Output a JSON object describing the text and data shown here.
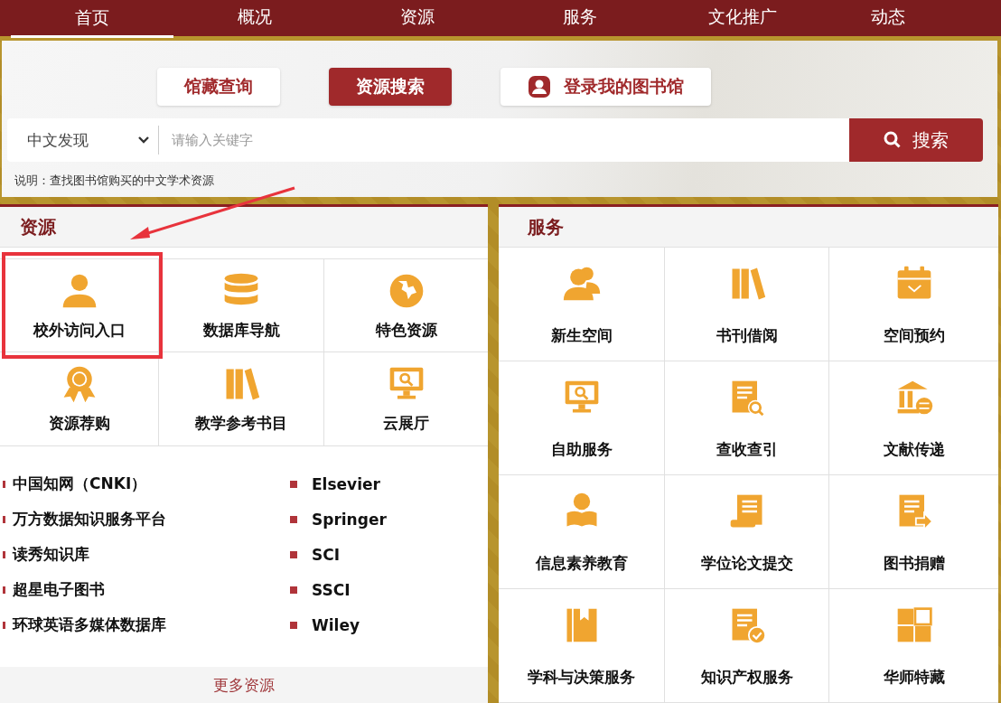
{
  "nav": [
    {
      "label": "首页",
      "selected": true
    },
    {
      "label": "概况",
      "selected": false
    },
    {
      "label": "资源",
      "selected": false
    },
    {
      "label": "服务",
      "selected": false
    },
    {
      "label": "文化推广",
      "selected": false
    },
    {
      "label": "动态",
      "selected": false
    }
  ],
  "search": {
    "tabs": [
      {
        "label": "馆藏查询",
        "selected": false
      },
      {
        "label": "资源搜索",
        "selected": true
      },
      {
        "label": "登录我的图书馆",
        "selected": false
      }
    ],
    "scope": "中文发现",
    "placeholder": "请输入关键字",
    "button": "搜索",
    "note": "说明：查找图书馆购买的中文学术资源"
  },
  "resources": {
    "title": "资源",
    "items": [
      {
        "label": "校外访问入口",
        "annotated": true
      },
      {
        "label": "数据库导航",
        "annotated": false
      },
      {
        "label": "特色资源",
        "annotated": false
      },
      {
        "label": "资源荐购",
        "annotated": false
      },
      {
        "label": "教学参考书目",
        "annotated": false
      },
      {
        "label": "云展厅",
        "annotated": false
      }
    ],
    "databases": [
      "中国知网（CNKI）",
      "Elsevier",
      "万方数据知识服务平台",
      "Springer",
      "读秀知识库",
      "SCI",
      "超星电子图书",
      "SSCI",
      "环球英语多媒体数据库",
      "Wiley"
    ],
    "more": "更多资源"
  },
  "services": {
    "title": "服务",
    "items": [
      "新生空间",
      "书刊借阅",
      "空间预约",
      "自助服务",
      "查收查引",
      "文献传递",
      "信息素养教育",
      "学位论文提交",
      "图书捐赠",
      "学科与决策服务",
      "知识产权服务",
      "华师特藏"
    ]
  }
}
